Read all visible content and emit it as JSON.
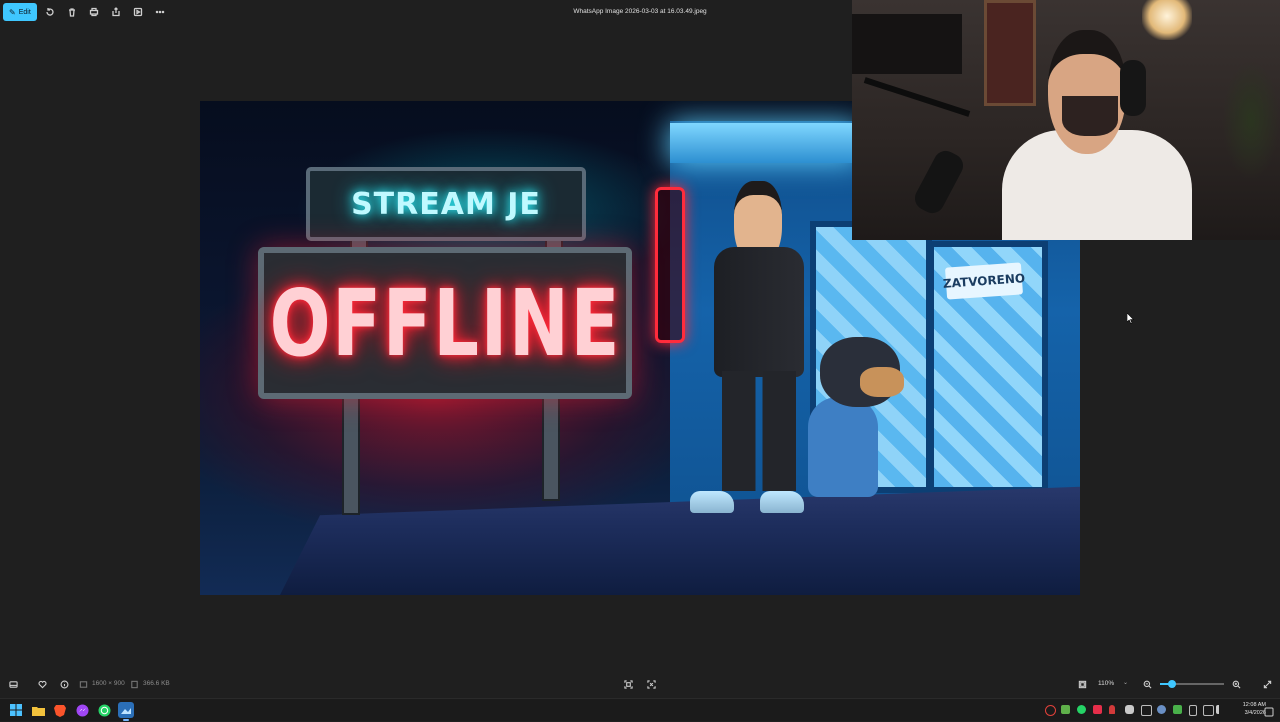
{
  "toolbar": {
    "edit_label": "Edit",
    "file_title": "WhatsApp Image 2026-03-03 at 16.03.49.jpeg",
    "icons": [
      "rotate-icon",
      "delete-icon",
      "print-icon",
      "share-icon",
      "slideshow-icon",
      "more-icon"
    ]
  },
  "image": {
    "sign_top_text": "STREAM JE",
    "sign_main_text": "OFFLINE",
    "door_sign_text": "ZATVORENO"
  },
  "status": {
    "dimensions": "1600 × 900",
    "file_size": "366.6 KB",
    "zoom": "110%",
    "zoom_fraction": 0.18
  },
  "taskbar": {
    "apps": [
      "start",
      "file-explorer",
      "brave-browser",
      "messenger",
      "whatsapp",
      "photos"
    ],
    "time": "12:08 AM",
    "date": "3/4/2026"
  },
  "colors": {
    "accent": "#3fc7ff",
    "neon_red": "#ff2a3a",
    "neon_cyan": "#2ff5ff",
    "background": "#1f1f1f"
  }
}
